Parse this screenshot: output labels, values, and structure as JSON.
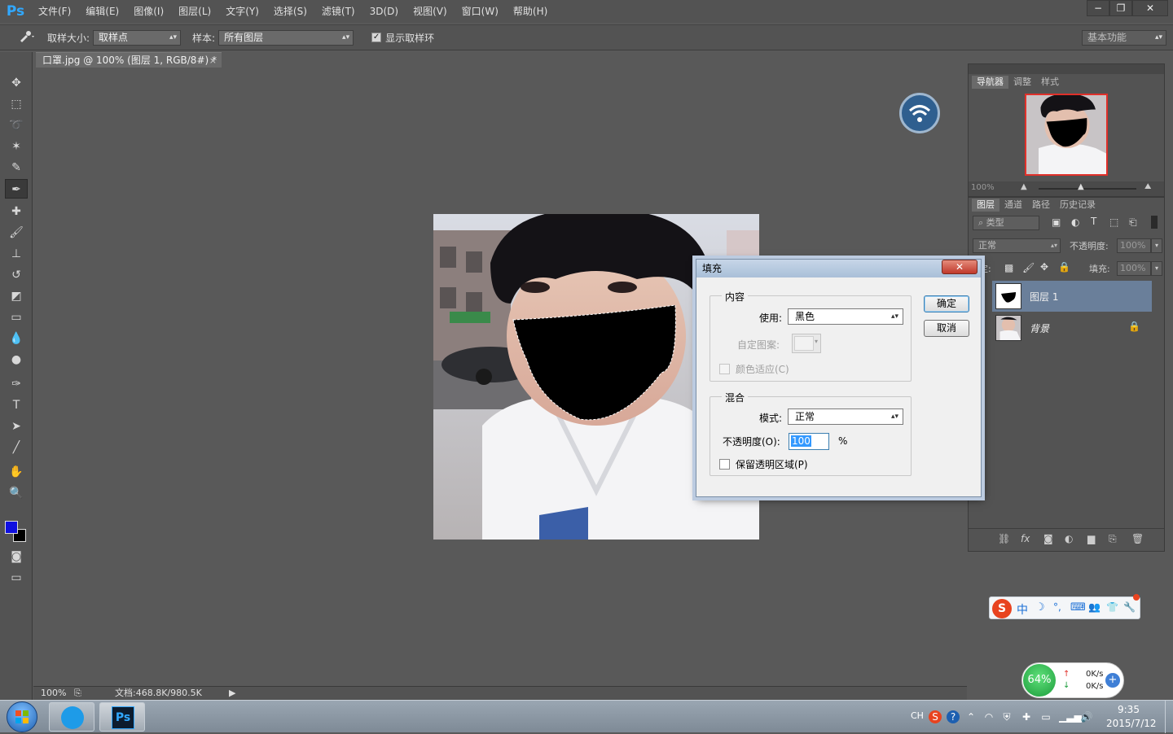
{
  "app": {
    "logo": "Ps"
  },
  "menu": [
    "文件(F)",
    "编辑(E)",
    "图像(I)",
    "图层(L)",
    "文字(Y)",
    "选择(S)",
    "滤镜(T)",
    "3D(D)",
    "视图(V)",
    "窗口(W)",
    "帮助(H)"
  ],
  "window_controls": {
    "minimize": "−",
    "restore": "❐",
    "close": "✕"
  },
  "options": {
    "sample_size_label": "取样大小:",
    "sample_size_value": "取样点",
    "sample_label": "样本:",
    "sample_value": "所有图层",
    "show_ring_label": "显示取样环",
    "show_ring_checked": true,
    "workspace": "基本功能"
  },
  "document": {
    "tab_title": "口罩.jpg @ 100% (图层 1, RGB/8#) *",
    "close": "×"
  },
  "status": {
    "zoom": "100%",
    "doc_info": "文档:468.8K/980.5K"
  },
  "navigator": {
    "tabs": [
      "导航器",
      "调整",
      "样式"
    ],
    "zoom": "100%"
  },
  "layers_panel": {
    "tabs": [
      "图层",
      "通道",
      "路径",
      "历史记录"
    ],
    "filter_label": "类型",
    "blend_mode": "正常",
    "opacity_label": "不透明度:",
    "opacity_value": "100%",
    "lock_label": "锁定:",
    "fill_label": "填充:",
    "fill_value": "100%",
    "layers": [
      {
        "name": "图层 1",
        "selected": true
      },
      {
        "name": "背景",
        "locked": true
      }
    ]
  },
  "fill_dialog": {
    "title": "填充",
    "close": "✕",
    "contents_group": "内容",
    "use_label": "使用:",
    "use_value": "黑色",
    "custom_pattern_label": "自定图案:",
    "color_adapt_label": "颜色适应(C)",
    "blending_group": "混合",
    "mode_label": "模式:",
    "mode_value": "正常",
    "opacity_label": "不透明度(O):",
    "opacity_value": "100",
    "opacity_unit": "%",
    "preserve_label": "保留透明区域(P)",
    "ok_label": "确定",
    "cancel_label": "取消"
  },
  "ime_bar": {
    "items": [
      "S",
      "中",
      "☽",
      "°,",
      "⌨",
      "👥",
      "👕",
      "🔧"
    ]
  },
  "net_widget": {
    "percent": "64%",
    "up": "0K/s",
    "down": "0K/s"
  },
  "taskbar": {
    "tray_lang": "CH",
    "time": "9:35",
    "date": "2015/7/12"
  },
  "colors": {
    "foreground": "#1010e0",
    "background": "#000000",
    "accent": "#31a8ff",
    "selected_layer": "#6a7f9a"
  }
}
